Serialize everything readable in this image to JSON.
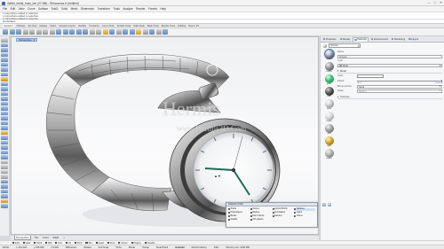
{
  "window": {
    "title": "Vahibi_metal_body_bm (27 MB) - Rhinoceros 6 (Untitled)",
    "controls": [
      "—",
      "□",
      "✕"
    ]
  },
  "menu": [
    "File",
    "Edit",
    "View",
    "Curve",
    "Surface",
    "SubD",
    "Solid",
    "Mesh",
    "Dimension",
    "Transform",
    "Tools",
    "Analyze",
    "Render",
    "Panels",
    "Help"
  ],
  "command_history": [
    "1 polysurface added to selection.",
    "1 polysurface added to selection.",
    "1 polysurface added to selection."
  ],
  "command_prompt": "Command:",
  "toolbar_tabs": [
    {
      "label": "Standard",
      "active": true
    },
    {
      "label": "CPlanes"
    },
    {
      "label": "Set View"
    },
    {
      "label": "Display"
    },
    {
      "label": "Select"
    },
    {
      "label": "Viewport Layout"
    },
    {
      "label": "Visibility"
    },
    {
      "label": "Transform"
    },
    {
      "label": "Curve Tools"
    },
    {
      "label": "Surface Tools"
    },
    {
      "label": "Solid Tools"
    },
    {
      "label": "Mesh Tools"
    },
    {
      "label": "Render Tools"
    },
    {
      "label": "Drafting"
    },
    {
      "label": "New in V6"
    }
  ],
  "viewport": {
    "label": "Perspective",
    "watermark_main": "Hermis",
    "watermark_url": "www.Hermis3D.Com"
  },
  "view_tabs": [
    {
      "label": "Perspective",
      "active": true
    },
    {
      "label": "Top"
    },
    {
      "label": "Front"
    },
    {
      "label": "Right"
    },
    {
      "label": "+"
    }
  ],
  "selection_filter": {
    "title": "Selection Filter",
    "items": [
      {
        "label": "Points",
        "checked": true
      },
      {
        "label": "Curves",
        "checked": true
      },
      {
        "label": "Control Points",
        "checked": true
      },
      {
        "label": "Surfaces",
        "checked": true,
        "selected": true
      },
      {
        "label": "Polysurfaces",
        "checked": true
      },
      {
        "label": "Meshes",
        "checked": true
      },
      {
        "label": "Annotations",
        "checked": true
      },
      {
        "label": "Lights",
        "checked": true
      },
      {
        "label": "Blocks",
        "checked": true
      },
      {
        "label": "Point Clouds",
        "checked": true
      },
      {
        "label": "Hatches",
        "checked": true
      },
      {
        "label": "Others",
        "checked": true
      },
      {
        "label": "Disable",
        "checked": false
      },
      {
        "label": "Sub-objects",
        "checked": true
      }
    ]
  },
  "osnap": [
    {
      "label": "End",
      "on": false
    },
    {
      "label": "Near",
      "on": false
    },
    {
      "label": "Point",
      "on": false
    },
    {
      "label": "Mid",
      "on": false
    },
    {
      "label": "Cen",
      "on": false
    },
    {
      "label": "Int",
      "on": false
    },
    {
      "label": "Perp",
      "on": false
    },
    {
      "label": "Tan",
      "on": false
    },
    {
      "label": "Quad",
      "on": false
    },
    {
      "label": "Knot",
      "on": false
    },
    {
      "label": "Vertex",
      "on": false
    },
    {
      "label": "Project",
      "on": false
    },
    {
      "label": "Disable",
      "on": false
    }
  ],
  "status": {
    "cplane": "World",
    "x": "x -214.218",
    "y": "y 155.039",
    "z": "z 0.000",
    "units": "Millimeters",
    "layer": "Default",
    "items": [
      "Grid Snap",
      "Ortho",
      "Planar",
      "Osnap",
      "SmartTrack",
      "Gumball",
      "Record History",
      "Filter"
    ],
    "bold_item": "Gumball",
    "memory": "Memory use: 1445 MB"
  },
  "right_panel": {
    "tabs": [
      {
        "label": "Properties"
      },
      {
        "label": "Display"
      },
      {
        "label": "Materials",
        "active": true
      },
      {
        "label": "Environments"
      },
      {
        "label": "Rendering"
      },
      {
        "label": "Layers"
      }
    ],
    "current_material": "chrome",
    "materials": [
      {
        "name": "chrome",
        "style": "chrome",
        "active": true
      },
      {
        "name": "chrome",
        "style": "steel"
      },
      {
        "name": "green",
        "style": "green"
      },
      {
        "name": "Dark",
        "style": "dark"
      },
      {
        "name": "Silver",
        "style": "silver"
      },
      {
        "name": "chrome",
        "style": "bright"
      },
      {
        "name": "steel",
        "style": "brushed"
      },
      {
        "name": "gold",
        "style": "gold"
      },
      {
        "name": "chrome",
        "style": "satin"
      }
    ],
    "props": {
      "name_label": "Name",
      "name_value": "chrome",
      "type_label": "Type",
      "type_value": "Metal",
      "section_metal": "Metal",
      "color_label": "Color",
      "polish_label": "Polish",
      "polish_left": "Matte",
      "polish_right": "Polished",
      "polish_value": 1,
      "bump_label": "Bump texture",
      "bump_value": "None",
      "scale_label": "Scale",
      "scale_value": "Medium",
      "section_textures": "Textures"
    }
  },
  "colors": {
    "accent": "#3f78c6",
    "panel": "#f6f7f8",
    "viewport_bg": "#f5f6f8"
  }
}
